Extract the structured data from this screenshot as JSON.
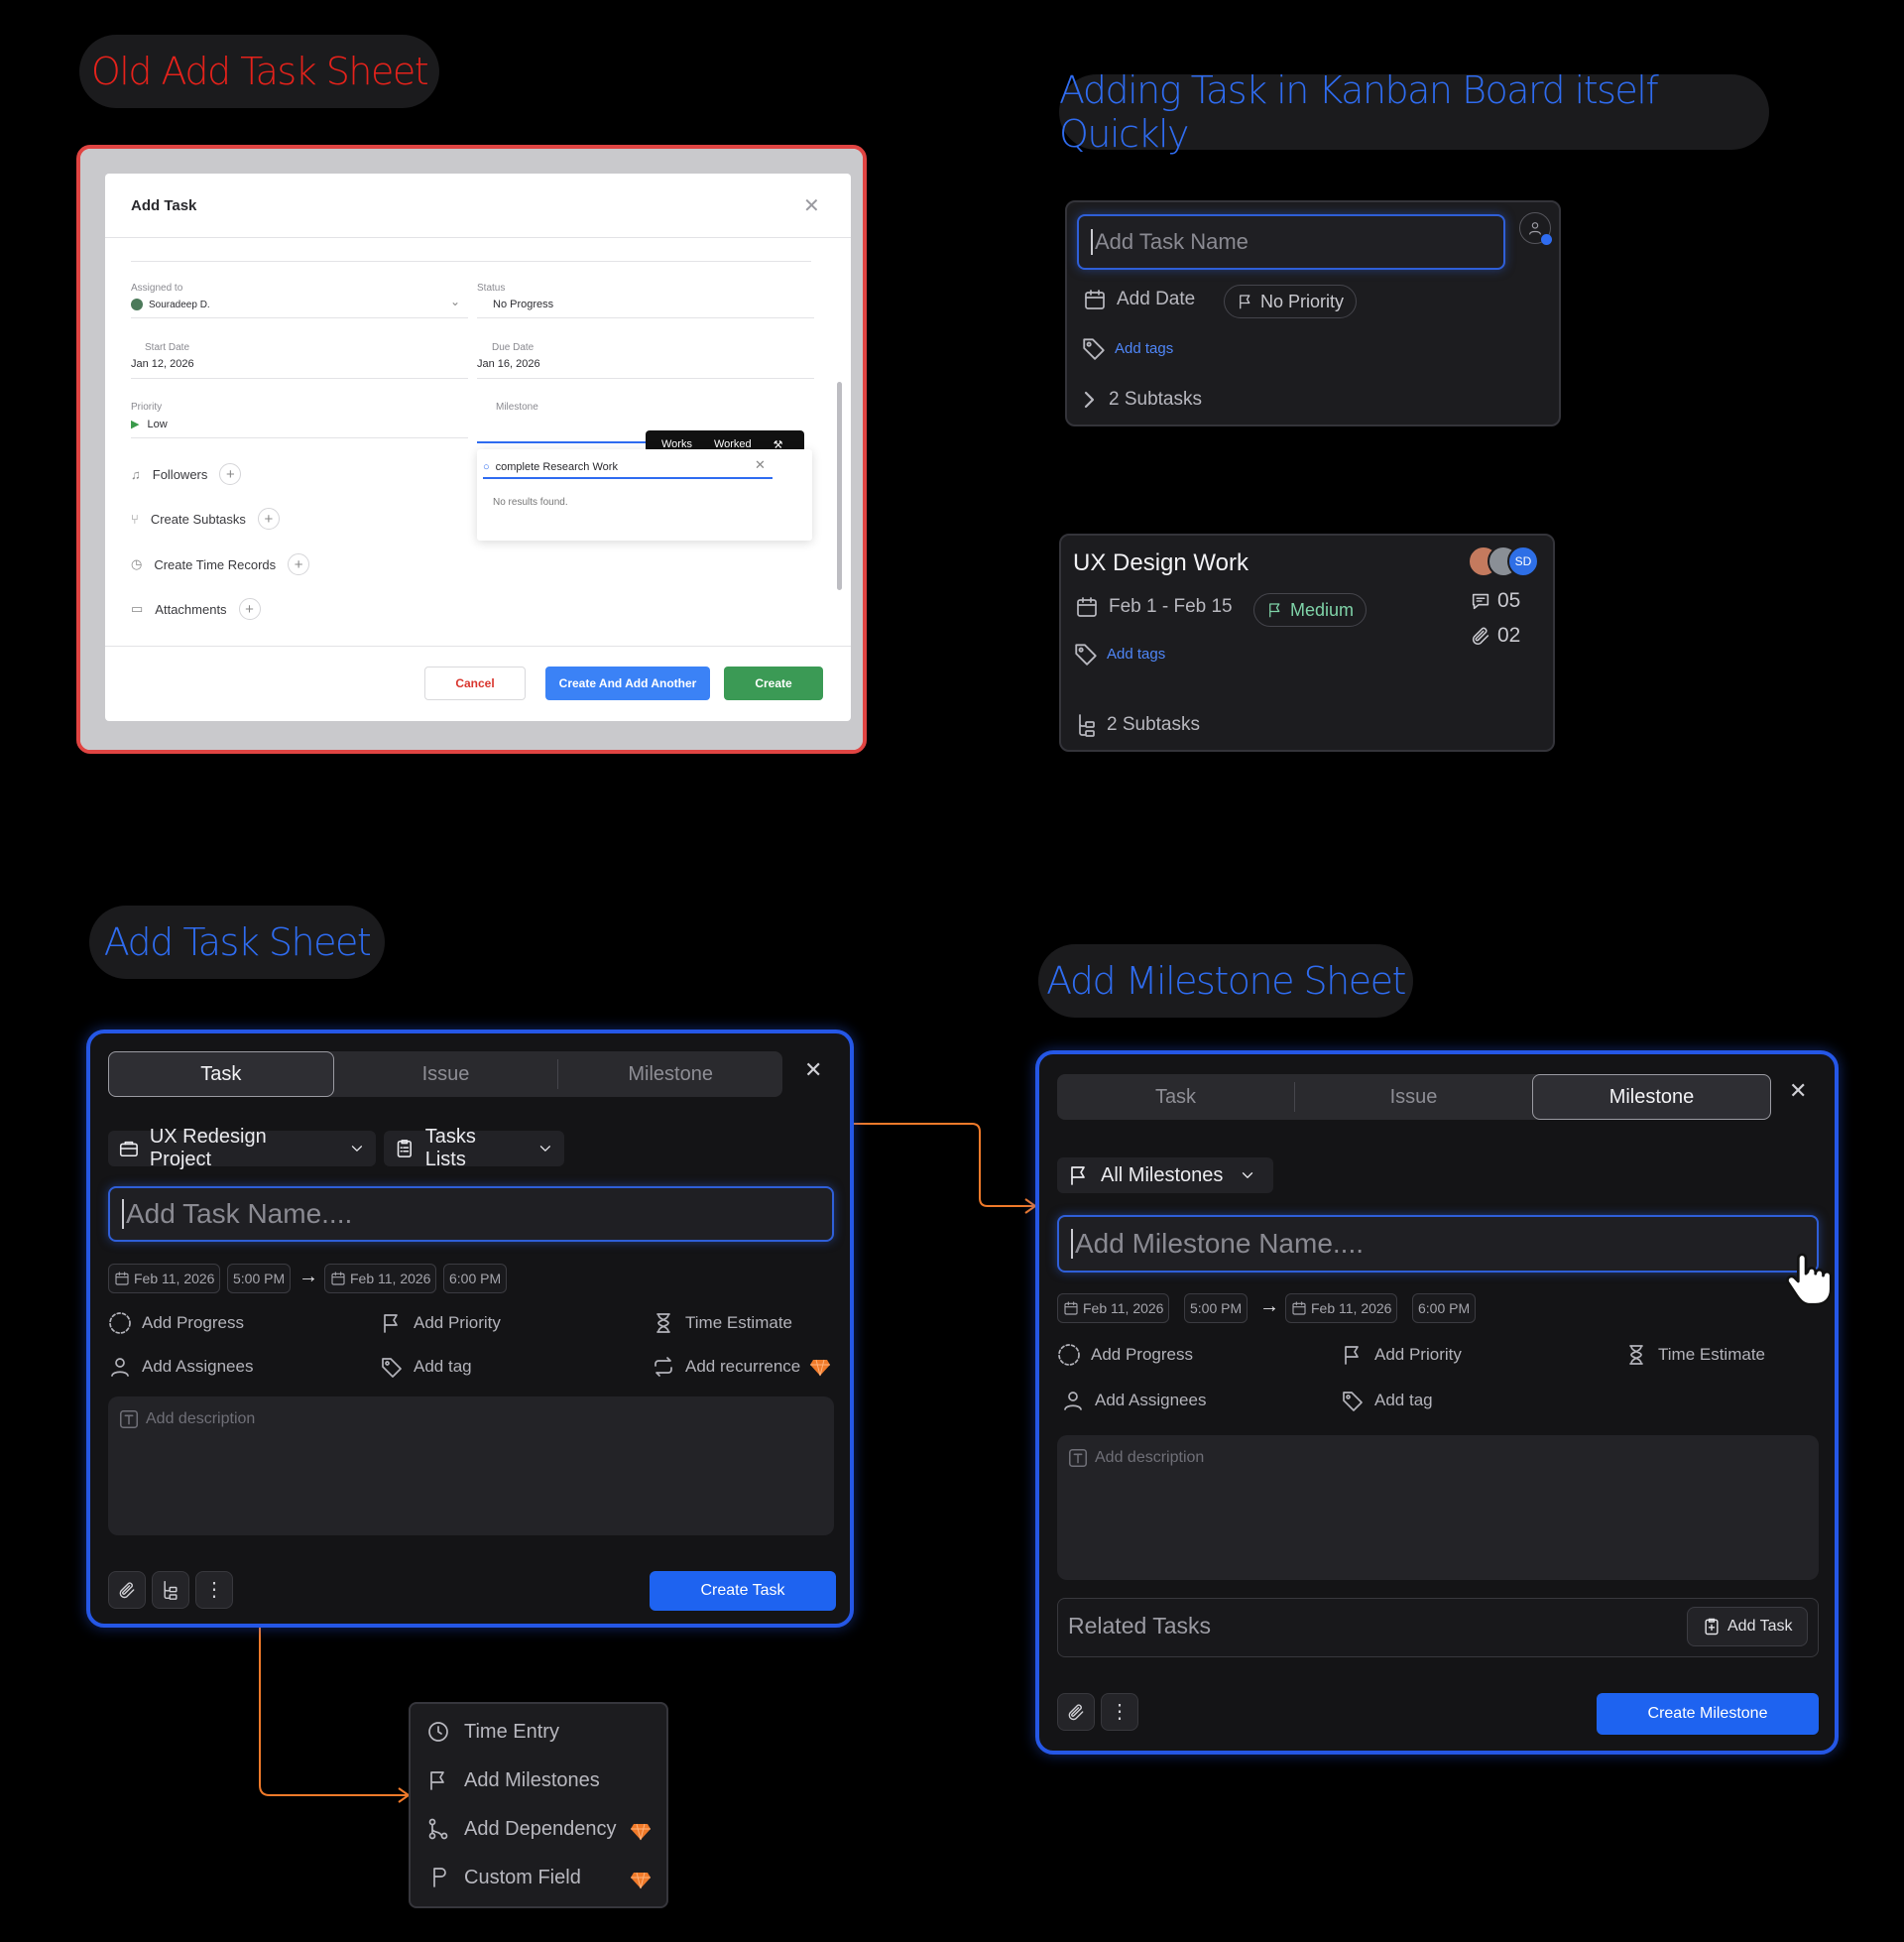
{
  "section_titles": {
    "old": "Old Add Task Sheet",
    "kanban": "Adding Task in Kanban Board itself Quickly",
    "add_task": "Add Task Sheet",
    "add_milestone": "Add Milestone Sheet"
  },
  "colors": {
    "accent": "#1e63f0",
    "old_border": "#e04442",
    "premium": "#f07a2a",
    "connector": "#f07a2a"
  },
  "old_sheet": {
    "title": "Add Task",
    "assigned_label": "Assigned to",
    "assigned_value": "Souradeep D.",
    "status_label": "Status",
    "status_value": "No Progress",
    "start_label": "Start Date",
    "start_value": "Jan 12, 2026",
    "due_label": "Due Date",
    "due_value": "Jan 16, 2026",
    "priority_label": "Priority",
    "priority_value": "Low",
    "milestone_label": "Milestone",
    "tooltip": [
      "Works",
      "Worked"
    ],
    "search_value": "complete Research Work",
    "no_results": "No results found.",
    "actions": [
      "Followers",
      "Create Subtasks",
      "Create Time Records",
      "Attachments"
    ],
    "cancel": "Cancel",
    "create_another": "Create And Add Another",
    "create": "Create"
  },
  "quick_add": {
    "placeholder": "Add Task Name",
    "date": "Add Date",
    "priority": "No Priority",
    "tags": "Add tags",
    "subtasks": "2 Subtasks"
  },
  "kanban_card": {
    "title": "UX Design Work",
    "avatar_initials": "SD",
    "dates": "Feb 1 - Feb 15",
    "priority": "Medium",
    "tags": "Add tags",
    "comments": "05",
    "attachments": "02",
    "subtasks": "2 Subtasks"
  },
  "task_sheet": {
    "tabs": [
      "Task",
      "Issue",
      "Milestone"
    ],
    "project": "UX Redesign Project",
    "list": "Tasks Lists",
    "placeholder": "Add Task Name....",
    "start_date": "Feb 11, 2026",
    "start_time": "5:00 PM",
    "end_date": "Feb 11, 2026",
    "end_time": "6:00 PM",
    "progress": "Add Progress",
    "priority": "Add Priority",
    "estimate": "Time Estimate",
    "assignees": "Add Assignees",
    "tag": "Add tag",
    "recurrence": "Add recurrence",
    "description": "Add description",
    "submit": "Create Task"
  },
  "more_menu": {
    "items": [
      "Time Entry",
      "Add Milestones",
      "Add Dependency",
      "Custom Field"
    ]
  },
  "milestone_sheet": {
    "tabs": [
      "Task",
      "Issue",
      "Milestone"
    ],
    "filter": "All Milestones",
    "placeholder": "Add Milestone Name....",
    "start_date": "Feb 11, 2026",
    "start_time": "5:00 PM",
    "end_date": "Feb 11, 2026",
    "end_time": "6:00 PM",
    "progress": "Add Progress",
    "priority": "Add Priority",
    "estimate": "Time Estimate",
    "assignees": "Add Assignees",
    "tag": "Add tag",
    "description": "Add description",
    "related_tasks": "Related Tasks",
    "add_task": "Add Task",
    "submit": "Create Milestone"
  }
}
